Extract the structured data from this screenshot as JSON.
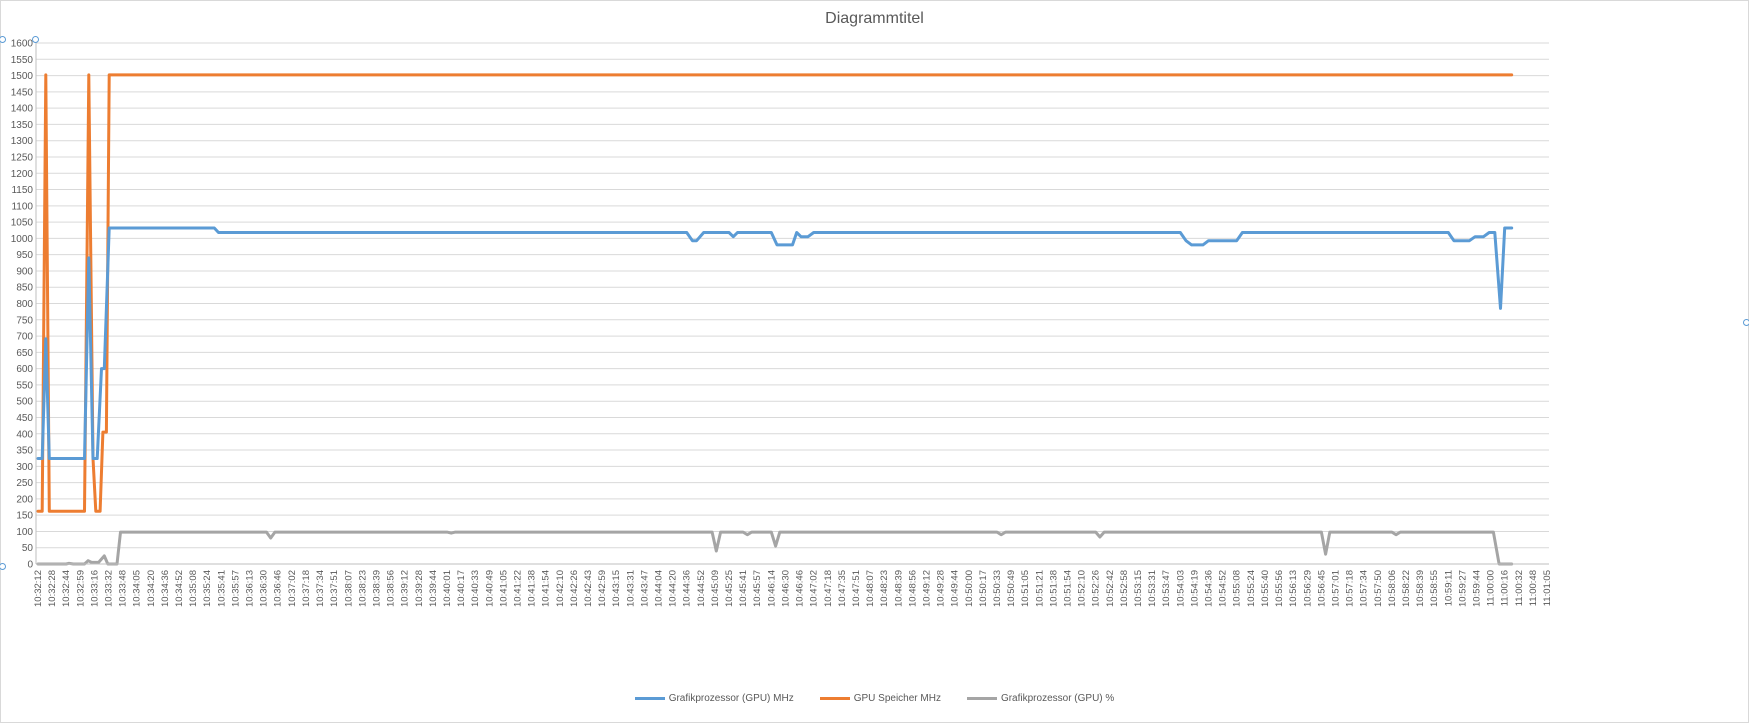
{
  "chart_data": {
    "type": "line",
    "title": "Diagrammtitel",
    "xlabel": "",
    "ylabel": "",
    "ylim": [
      0,
      1600
    ],
    "yticks": [
      0,
      50,
      100,
      150,
      200,
      250,
      300,
      350,
      400,
      450,
      500,
      550,
      600,
      650,
      700,
      750,
      800,
      850,
      900,
      950,
      1000,
      1050,
      1100,
      1150,
      1200,
      1250,
      1300,
      1350,
      1400,
      1450,
      1500,
      1550,
      1600
    ],
    "x_tick_labels": [
      "10:32:12",
      "10:32:28",
      "10:32:44",
      "10:32:59",
      "10:33:16",
      "10:33:32",
      "10:33:48",
      "10:34:05",
      "10:34:20",
      "10:34:36",
      "10:34:52",
      "10:35:08",
      "10:35:24",
      "10:35:41",
      "10:35:57",
      "10:36:13",
      "10:36:30",
      "10:36:46",
      "10:37:02",
      "10:37:18",
      "10:37:34",
      "10:37:51",
      "10:38:07",
      "10:38:23",
      "10:38:39",
      "10:38:56",
      "10:39:12",
      "10:39:28",
      "10:39:44",
      "10:40:01",
      "10:40:17",
      "10:40:33",
      "10:40:49",
      "10:41:05",
      "10:41:22",
      "10:41:38",
      "10:41:54",
      "10:42:10",
      "10:42:26",
      "10:42:43",
      "10:42:59",
      "10:43:15",
      "10:43:31",
      "10:43:47",
      "10:44:04",
      "10:44:20",
      "10:44:36",
      "10:44:52",
      "10:45:09",
      "10:45:25",
      "10:45:41",
      "10:45:57",
      "10:46:14",
      "10:46:30",
      "10:46:46",
      "10:47:02",
      "10:47:18",
      "10:47:35",
      "10:47:51",
      "10:48:07",
      "10:48:23",
      "10:48:39",
      "10:48:56",
      "10:49:12",
      "10:49:28",
      "10:49:44",
      "10:50:00",
      "10:50:17",
      "10:50:33",
      "10:50:49",
      "10:51:05",
      "10:51:21",
      "10:51:38",
      "10:51:54",
      "10:52:10",
      "10:52:26",
      "10:52:42",
      "10:52:58",
      "10:53:15",
      "10:53:31",
      "10:53:47",
      "10:54:03",
      "10:54:19",
      "10:54:36",
      "10:54:52",
      "10:55:08",
      "10:55:24",
      "10:55:40",
      "10:55:56",
      "10:56:13",
      "10:56:29",
      "10:56:45",
      "10:57:01",
      "10:57:18",
      "10:57:34",
      "10:57:50",
      "10:58:06",
      "10:58:22",
      "10:58:39",
      "10:58:55",
      "10:59:11",
      "10:59:27",
      "10:59:44",
      "11:00:00",
      "11:00:16",
      "11:00:32",
      "11:00:48",
      "11:01:05"
    ],
    "legend_position": "bottom",
    "grid": true,
    "series": [
      {
        "name": "Grafikprozessor (GPU) MHz",
        "color": "#5b9bd5",
        "points": [
          [
            0,
            324
          ],
          [
            0.3,
            324
          ],
          [
            0.55,
            692
          ],
          [
            0.8,
            324
          ],
          [
            1,
            324
          ],
          [
            2,
            324
          ],
          [
            3,
            324
          ],
          [
            3.3,
            324
          ],
          [
            3.6,
            940
          ],
          [
            3.9,
            324
          ],
          [
            4.2,
            324
          ],
          [
            4.5,
            600
          ],
          [
            4.7,
            600
          ],
          [
            5.05,
            1032
          ],
          [
            6,
            1032
          ],
          [
            8,
            1032
          ],
          [
            12.5,
            1032
          ],
          [
            12.8,
            1018
          ],
          [
            46,
            1018
          ],
          [
            46.4,
            993
          ],
          [
            46.7,
            993
          ],
          [
            47.2,
            1018
          ],
          [
            49,
            1018
          ],
          [
            49.3,
            1005
          ],
          [
            49.6,
            1018
          ],
          [
            52,
            1018
          ],
          [
            52.4,
            980
          ],
          [
            53.5,
            980
          ],
          [
            53.8,
            1018
          ],
          [
            54.1,
            1005
          ],
          [
            54.6,
            1005
          ],
          [
            55,
            1018
          ],
          [
            81,
            1018
          ],
          [
            81.4,
            993
          ],
          [
            81.8,
            980
          ],
          [
            82.6,
            980
          ],
          [
            83,
            993
          ],
          [
            85,
            993
          ],
          [
            85.4,
            1018
          ],
          [
            100,
            1018
          ],
          [
            100.4,
            993
          ],
          [
            101.5,
            993
          ],
          [
            101.9,
            1005
          ],
          [
            102.5,
            1005
          ],
          [
            102.9,
            1018
          ],
          [
            103.3,
            1018
          ],
          [
            103.7,
            785
          ],
          [
            104,
            1032
          ],
          [
            104.5,
            1032
          ]
        ]
      },
      {
        "name": "GPU Speicher MHz",
        "color": "#ed7d31",
        "points": [
          [
            0,
            162
          ],
          [
            0.3,
            162
          ],
          [
            0.55,
            1502
          ],
          [
            0.8,
            162
          ],
          [
            1,
            162
          ],
          [
            2,
            162
          ],
          [
            3,
            162
          ],
          [
            3.3,
            162
          ],
          [
            3.6,
            1502
          ],
          [
            3.9,
            324
          ],
          [
            4.1,
            162
          ],
          [
            4.4,
            162
          ],
          [
            4.6,
            405
          ],
          [
            4.85,
            405
          ],
          [
            5.05,
            1502
          ],
          [
            10,
            1502
          ],
          [
            104.5,
            1502
          ]
        ]
      },
      {
        "name": "Grafikprozessor (GPU) %",
        "color": "#a5a5a5",
        "points": [
          [
            0,
            0
          ],
          [
            1,
            0
          ],
          [
            2,
            0
          ],
          [
            2.2,
            2
          ],
          [
            2.5,
            0
          ],
          [
            3.3,
            0
          ],
          [
            3.55,
            10
          ],
          [
            3.8,
            5
          ],
          [
            4.3,
            5
          ],
          [
            4.7,
            25
          ],
          [
            4.95,
            0
          ],
          [
            5.6,
            0
          ],
          [
            5.85,
            98
          ],
          [
            12,
            98
          ],
          [
            12.5,
            98
          ],
          [
            16.2,
            98
          ],
          [
            16.5,
            80
          ],
          [
            16.8,
            98
          ],
          [
            29,
            98
          ],
          [
            29.3,
            95
          ],
          [
            29.6,
            98
          ],
          [
            45,
            98
          ],
          [
            45.7,
            98
          ],
          [
            47.8,
            98
          ],
          [
            48.1,
            40
          ],
          [
            48.4,
            98
          ],
          [
            50,
            98
          ],
          [
            50.3,
            90
          ],
          [
            50.6,
            98
          ],
          [
            52,
            98
          ],
          [
            52.3,
            55
          ],
          [
            52.6,
            98
          ],
          [
            68,
            98
          ],
          [
            68.3,
            90
          ],
          [
            68.6,
            98
          ],
          [
            75,
            98
          ],
          [
            75.3,
            83
          ],
          [
            75.6,
            98
          ],
          [
            91,
            98
          ],
          [
            91.3,
            30
          ],
          [
            91.6,
            98
          ],
          [
            96,
            98
          ],
          [
            96.3,
            90
          ],
          [
            96.6,
            98
          ],
          [
            103.2,
            98
          ],
          [
            103.6,
            0
          ],
          [
            104.5,
            0
          ]
        ]
      }
    ]
  }
}
